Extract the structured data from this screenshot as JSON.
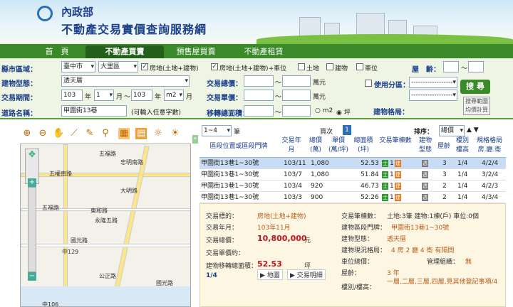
{
  "header": {
    "org": "內政部",
    "title": "不動產交易實價查詢服務網"
  },
  "nav": {
    "tabs": [
      "首　頁",
      "不動產買賣",
      "預售屋買賣",
      "不動產租賃"
    ]
  },
  "form": {
    "city_label": "縣市區域：",
    "city": "臺中市",
    "district": "大里區",
    "types": [
      "房地(土地+建物)",
      "房地(土地+建物)+車位",
      "土地",
      "建物",
      "車位"
    ],
    "age_label": "屋　齡：",
    "build_type_label": "建物型態：",
    "build_type": "透天厝",
    "price_label": "交易總價：",
    "unit_wan": "萬元",
    "period_label": "交易期間：",
    "y1": "103",
    "m1": "1",
    "y2": "103",
    "m2": "m2",
    "year": "年",
    "month": "月",
    "to": "～",
    "unit_price_label": "交易單價：",
    "road_label": "道路名稱：",
    "road": "甲圍街13巷",
    "road_hint": "(可輸入任意字數)",
    "area_label": "移轉總面積：",
    "ping": "坪",
    "use_label": "使用分區：",
    "use_placeholder": "-------------------",
    "layout_label": "建物格局：",
    "search": "搜 尋",
    "calc": "搜尋範圍均價計算"
  },
  "results": {
    "range_select": "1~4",
    "pen": "筆",
    "page_label": "頁次",
    "page": "1",
    "sort_label": "排序：",
    "sort": "總價",
    "sort_arrows": "▲ ▼",
    "headers": {
      "addr": "區段位置或區段門牌",
      "date": "交易年月",
      "total": "總價(萬)",
      "unit": "單價(萬/坪)",
      "area": "總面積(坪)",
      "count": "交易筆棟數",
      "type": "建物型態",
      "floor": "屋齡",
      "level": "樓別樓高",
      "layout": "規格格局房.廳.衛"
    },
    "rows": [
      {
        "addr": "甲圍街13巷1~30號",
        "date": "103/11",
        "total": "1,080",
        "area": "52.53",
        "type": "透",
        "age": "3",
        "level": "1/4",
        "layout": "4/2/4"
      },
      {
        "addr": "甲圍街13巷1~30號",
        "date": "103/7",
        "total": "1,080",
        "area": "51.84",
        "type": "透",
        "age": "3",
        "level": "1/4",
        "layout": "3/2/4"
      },
      {
        "addr": "甲圍街13巷1~30號",
        "date": "103/4",
        "total": "920",
        "area": "46.73",
        "type": "透",
        "age": "2",
        "level": "1/4",
        "layout": "4/2/3"
      },
      {
        "addr": "甲圍街13巷1~30號",
        "date": "103/3",
        "total": "900",
        "area": "52.26",
        "type": "透",
        "age": "2",
        "level": "1/4",
        "layout": "4/3/4"
      }
    ],
    "icon_land": "土",
    "icon_build": "建",
    "icon_n": "1"
  },
  "detail": {
    "k1": "交易標的：",
    "v1": "房地(土地+建物)",
    "k2": "交易年月：",
    "v2": "103年11月",
    "k3": "交易總價：",
    "v3": "10,800,000",
    "v3u": "元",
    "k4": "交易單價約：",
    "k5": "建物移轉總面積：",
    "v5": "52.53",
    "v5u": "坪",
    "pg": "1/4",
    "map_link": "地圖",
    "detail_link": "交易明細",
    "r1": "交易筆棟數：",
    "r1v": "土地:3筆 建物:1棟(戶) 車位:0個",
    "r2": "建物區段門牌：",
    "r2v": "甲圍街13巷1~30號",
    "r3": "建物型態：",
    "r3v": "透天厝",
    "r4": "建物現況格局：",
    "r4v": "4 房 2 廳 4 衛 有隔間",
    "r5": "車位總價：",
    "r5b": "管理組織：",
    "r5bv": "無",
    "r6": "屋齡：",
    "r6v": "3 年",
    "r7": "樓別/樓高：",
    "r7v": "一層,二層,三層,四層,見其他登記事項/4"
  },
  "map": {
    "labels": [
      "五權南路",
      "忠明南路",
      "五福路",
      "大明路",
      "五福路",
      "東和路",
      "永隆五路",
      "國光路",
      "公正路",
      "福",
      "中129",
      "忠",
      "大明路",
      "福",
      "立",
      "文",
      "國光路",
      "路",
      "中106"
    ],
    "icons": [
      "zoom-in-icon",
      "zoom-out-icon",
      "pan-icon",
      "measure-icon",
      "draw-icon",
      "locate-icon",
      "layer-icon",
      "grid-icon",
      "sun-icon",
      "sun2-icon"
    ]
  }
}
